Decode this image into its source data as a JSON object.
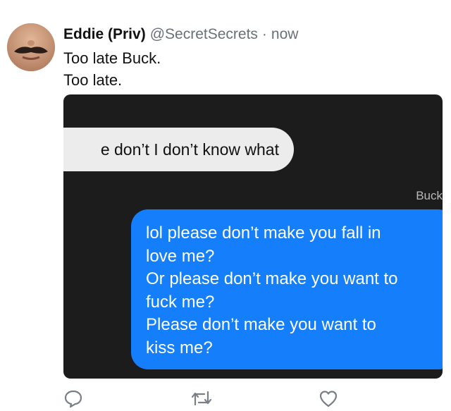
{
  "tweet": {
    "author_name": "Eddie (Priv)",
    "handle": "@SecretSecrets",
    "separator": "·",
    "time": "now",
    "text_lines": [
      "Too late Buck.",
      "Too late."
    ]
  },
  "screenshot": {
    "incoming_text": "e don’t I don’t know what",
    "sender_label": "Buck",
    "outgoing_lines": [
      "lol please don’t make you fall in",
      "love me?",
      "Or please don’t make you want to",
      "fuck me?",
      "Please don’t make you want to",
      "kiss me?"
    ]
  },
  "actions": {
    "icons": [
      "reply-icon",
      "retweet-icon",
      "like-icon"
    ]
  },
  "colors": {
    "outgoing_bubble": "#147efb",
    "incoming_bubble": "#ececec",
    "media_background": "#1c1c1c",
    "meta_text": "#6b7076"
  }
}
